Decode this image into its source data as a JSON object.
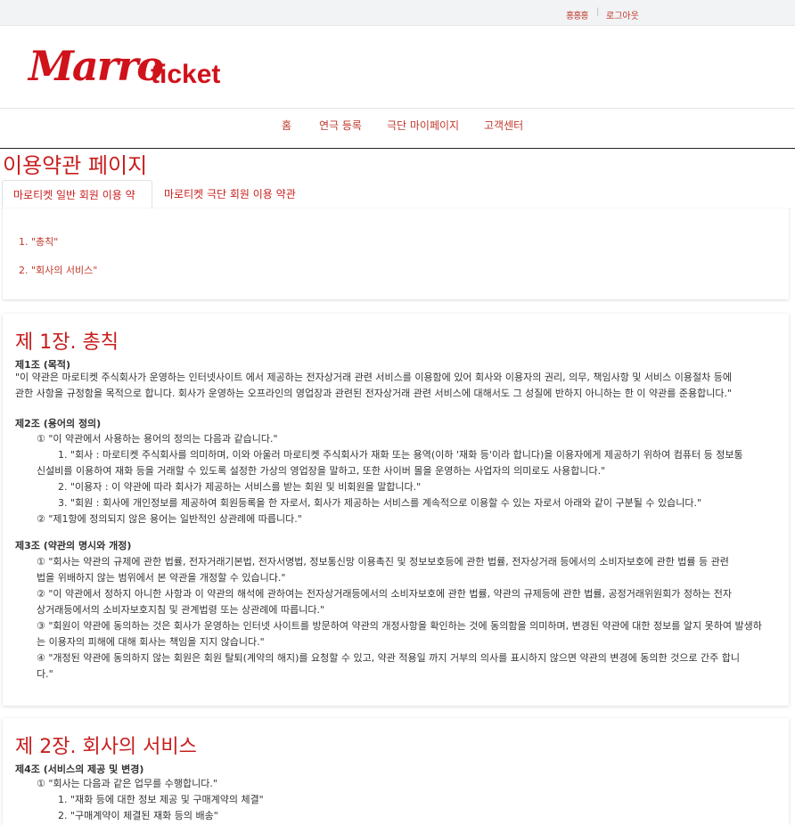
{
  "topbar": {
    "user": "홍홍홍",
    "separator": "|",
    "logout": "로그아웃"
  },
  "logo": {
    "marro": "Marro",
    "ticket": "ticket"
  },
  "nav": {
    "home": "홈",
    "play_register": "연극 등록",
    "troupe_mypage": "극단 마이페이지",
    "support": "고객센터"
  },
  "page_title": "이용약관 페이지",
  "tabs": [
    {
      "label": "마로티켓 일반 회원 이용 약관",
      "active": true
    },
    {
      "label": "마로티켓 극단 회원 이용 약관",
      "active": false
    }
  ],
  "toc": [
    "1. \"총칙\"",
    "2. \"회사의 서비스\""
  ],
  "chapter1": {
    "title": "제 1장. 총칙",
    "art1_title": "제1조 (목적)",
    "art1_p1": "\"이 약관은 마로티켓 주식회사가 운영하는 인터넷사이트 에서 제공하는 전자상거래 관련 서비스를 이용함에 있어 회사와 이용자의 권리, 의무, 책임사항 및 서비스 이용절차 등에",
    "art1_p2": "관한 사항을 규정함을 목적으로 합니다. 회사가 운영하는 오프라인의 영업장과 관련된 전자상거래 관련 서비스에 대해서도 그 성질에 반하지 아니하는 한 이 약관를 준용합니다.\"",
    "art2_title": "제2조 (용어의 정의)",
    "art2_c1": "① \"이 약관에서 사용하는 용어의 정의는 다음과 같습니다.\"",
    "art2_i1a": "1. \"회사 : 마로티켓 주식회사를 의미하며, 이와 아울러 마로티켓 주식회사가 재화 또는 용역(이하 '재화 등'이라 합니다)을 이용자에게 제공하기 위하여 컴퓨터 등 정보통",
    "art2_i1b": "신설비를 이용하여 재화 등을 거래할 수 있도록 설정한 가상의 영업장을 말하고, 또한 사이버 몰을 운영하는 사업자의 의미로도 사용합니다.\"",
    "art2_i2": "2. \"이용자 : 이 약관에 따라 회사가 제공하는 서비스를 받는 회원 및 비회원을 말합니다.\"",
    "art2_i3": "3. \"회원 : 회사에 개인정보를 제공하여 회원등록을 한 자로서, 회사가 제공하는 서비스를 계속적으로 이용할 수 있는 자로서 아래와 같이 구분될 수 있습니다.\"",
    "art2_c2": "② \"제1항에 정의되지 않은 용어는 일반적인 상관례에 따릅니다.\"",
    "art3_title": "제3조 (약관의 명시와 개정)",
    "art3_c1a": "① \"회사는 약관의 규제에 관한 법률, 전자거래기본법, 전자서명법, 정보통신망 이용촉진 및 정보보호등에 관한 법률, 전자상거래 등에서의 소비자보호에 관한 법률 등 관련",
    "art3_c1b": "법을 위배하지 않는 범위에서 본 약관을 개정할 수 있습니다.\"",
    "art3_c2a": "② \"이 약관에서 정하지 아니한 사항과 이 약관의 해석에 관하여는 전자상거래등에서의 소비자보호에 관한 법률, 약관의 규제등에 관한 법률, 공정거래위원회가 정하는 전자",
    "art3_c2b": "상거래등에서의 소비자보호지침 및 관계법령 또는 상관례에 따릅니다.\"",
    "art3_c3a": "③ \"회원이 약관에 동의하는 것은 회사가 운영하는 인터넷 사이트를 방문하여 약관의 개정사항을 확인하는 것에 동의함을 의미하며, 변경된 약관에 대한 정보를 알지 못하여 발생하",
    "art3_c3b": "는 이용자의 피해에 대해 회사는 책임을 지지 않습니다.\"",
    "art3_c4a": "④ \"개정된 약관에 동의하지 않는 회원은 회원 탈퇴(계약의 해지)를 요청할 수 있고, 약관 적용일 까지 거부의 의사를 표시하지 않으면 약관의 변경에 동의한 것으로 간주 합니",
    "art3_c4b": "다.\""
  },
  "chapter2": {
    "title": "제 2장. 회사의 서비스",
    "art4_title": "제4조 (서비스의 제공 및 변경)",
    "art4_c1": "① \"회사는 다음과 같은 업무를 수행합니다.\"",
    "art4_i1": "1. \"재화 등에 대한 정보 제공 및 구매계약의 체결\"",
    "art4_i2": "2. \"구매계약이 체결된 재화 등의 배송\""
  },
  "colors": {
    "accent": "#c81e1e",
    "link": "#c0392b"
  }
}
